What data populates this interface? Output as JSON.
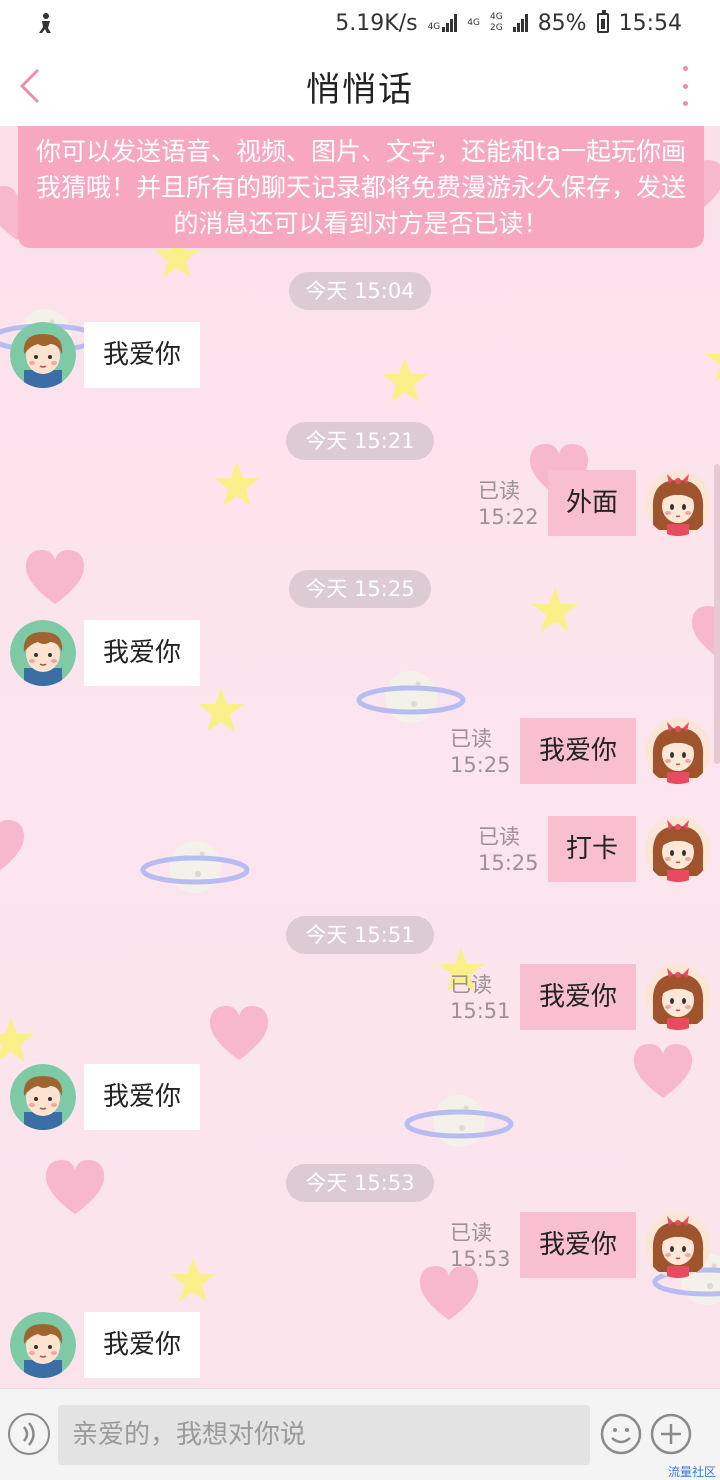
{
  "status_bar": {
    "speed": "5.19K/s",
    "network1": "4G",
    "network2": "4G",
    "network3a": "4G",
    "network3b": "2G",
    "battery": "85%",
    "time": "15:54"
  },
  "header": {
    "title": "悄悄话"
  },
  "notice": {
    "text": "你可以发送语音、视频、图片、文字，还能和ta一起玩你画我猜哦！并且所有的聊天记录都将免费漫游永久保存，发送的消息还可以看到对方是否已读！"
  },
  "timestamps": [
    "今天 15:04",
    "今天 15:21",
    "今天 15:25",
    "今天 15:51",
    "今天 15:53"
  ],
  "messages": [
    {
      "side": "incoming",
      "text": "我爱你"
    },
    {
      "side": "outgoing",
      "text": "外面",
      "read": "已读",
      "time": "15:22"
    },
    {
      "side": "incoming",
      "text": "我爱你"
    },
    {
      "side": "outgoing",
      "text": "我爱你",
      "read": "已读",
      "time": "15:25"
    },
    {
      "side": "outgoing",
      "text": "打卡",
      "read": "已读",
      "time": "15:25"
    },
    {
      "side": "outgoing",
      "text": "我爱你",
      "read": "已读",
      "time": "15:51"
    },
    {
      "side": "incoming",
      "text": "我爱你"
    },
    {
      "side": "outgoing",
      "text": "我爱你",
      "read": "已读",
      "time": "15:53"
    },
    {
      "side": "incoming",
      "text": "我爱你"
    }
  ],
  "input": {
    "placeholder": "亲爱的，我想对你说"
  },
  "watermark": "流量社区",
  "colors": {
    "accent_pink": "#f7a8be",
    "outgoing_bubble": "#f7bfd0",
    "incoming_bubble": "#ffffff",
    "chat_background": "#fbe0ea"
  },
  "icons": [
    "back-icon",
    "more-icon",
    "voice-icon",
    "emoji-icon",
    "plus-icon",
    "battery-icon",
    "signal-icon"
  ]
}
